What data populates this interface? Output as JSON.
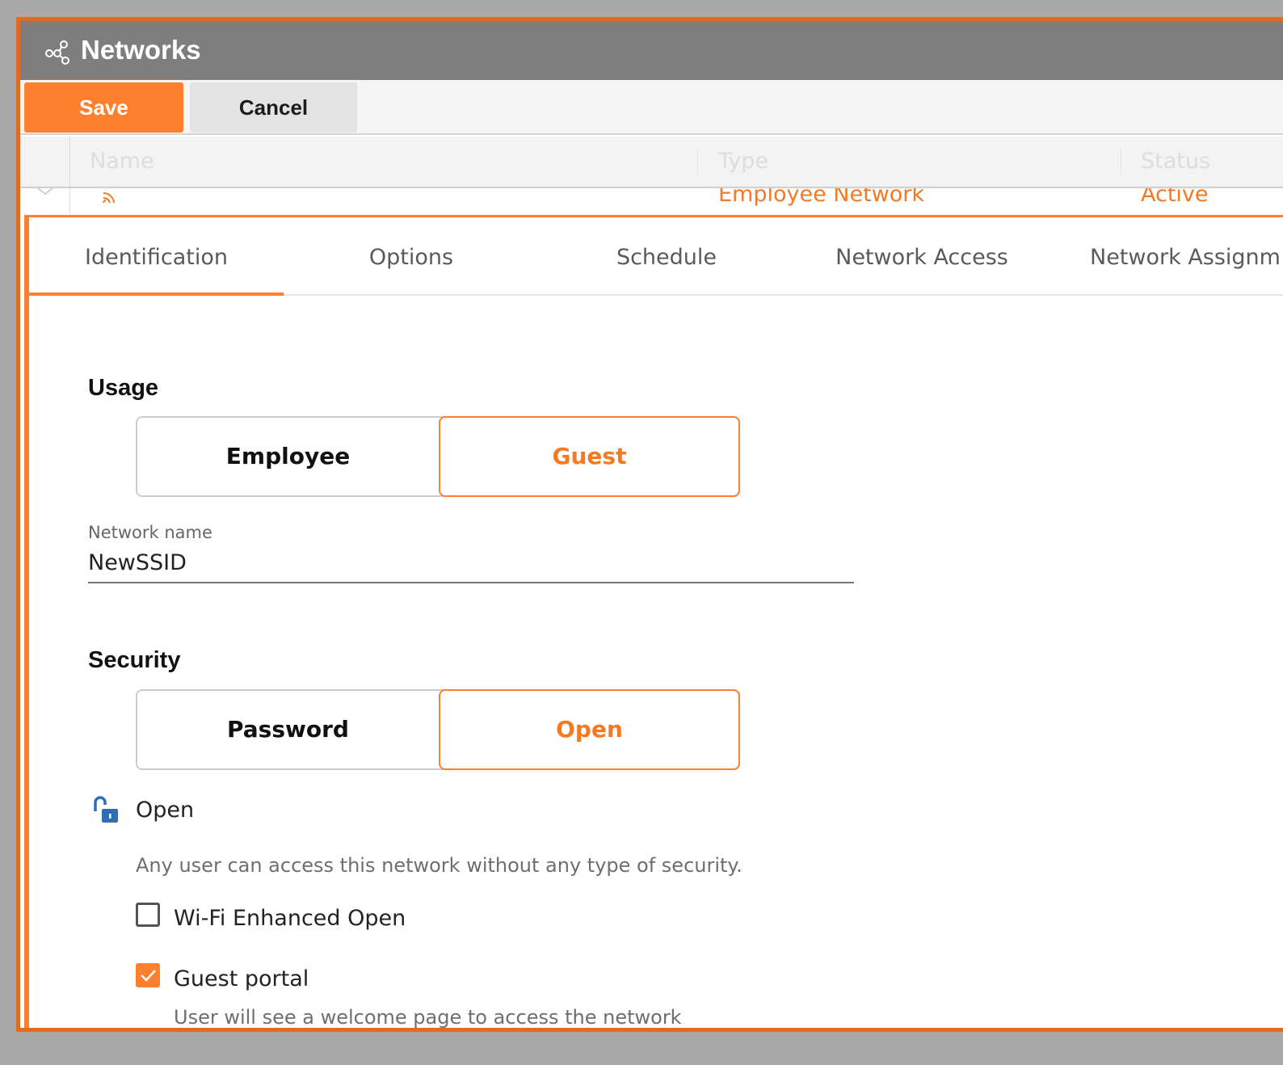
{
  "app": {
    "title": "Networks"
  },
  "toolbar": {
    "save_label": "Save",
    "cancel_label": "Cancel"
  },
  "table": {
    "columns": [
      "Name",
      "Type",
      "Status"
    ],
    "row": {
      "type": "Employee Network",
      "status": "Active"
    }
  },
  "tabs": [
    "Identification",
    "Options",
    "Schedule",
    "Network Access",
    "Network Assignm"
  ],
  "usage": {
    "title": "Usage",
    "left": "Employee",
    "right": "Guest"
  },
  "network_name": {
    "label": "Network name",
    "value": "NewSSID"
  },
  "security": {
    "title": "Security",
    "left": "Password",
    "right": "Open",
    "mode_label": "Open",
    "description": "Any user can access this network without any type of security.",
    "options": [
      {
        "label": "Wi-Fi Enhanced Open",
        "checked": false
      },
      {
        "label": "Guest portal",
        "checked": true,
        "hint": "User will see a welcome page to access the network"
      }
    ]
  },
  "colors": {
    "accent": "#fe7f2d",
    "titlebar": "#7e7e7e",
    "lock": "#2f6fb3"
  }
}
